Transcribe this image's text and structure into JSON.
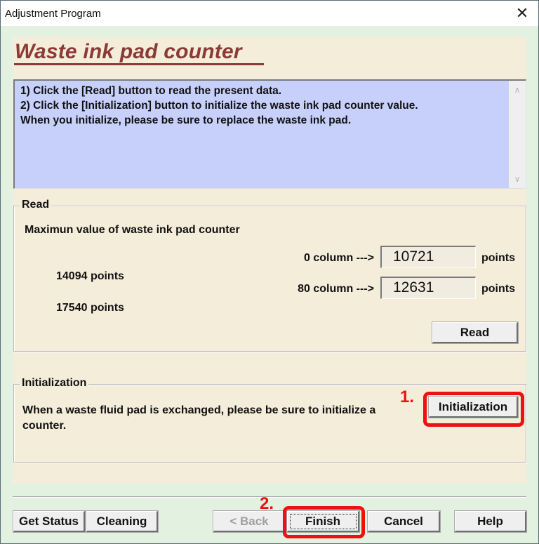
{
  "window": {
    "title": "Adjustment Program",
    "close_icon": "✕"
  },
  "header": {
    "title": "Waste ink pad counter"
  },
  "instructions": {
    "lines": [
      "1) Click the [Read] button to read the present data.",
      "2) Click the [Initialization] button to initialize the waste ink pad counter value.",
      "When you initialize, please be sure to replace the waste ink pad."
    ],
    "scroll_up_icon": "∧",
    "scroll_down_icon": "∨"
  },
  "read_group": {
    "label": "Read",
    "max_label": "Maximun value of waste ink pad counter",
    "max_values": [
      "14094 points",
      "17540 points"
    ],
    "columns": [
      {
        "label": "0 column --->",
        "value": "10721",
        "unit": "points"
      },
      {
        "label": "80 column --->",
        "value": "12631",
        "unit": "points"
      }
    ],
    "read_button": "Read"
  },
  "init_group": {
    "label": "Initialization",
    "text": "When a waste fluid pad is exchanged, please be sure to initialize a counter.",
    "button": "Initialization"
  },
  "annotations": {
    "step1": "1.",
    "step2": "2.",
    "color": "#ee1111"
  },
  "footer": {
    "get_status": "Get Status",
    "cleaning": "Cleaning",
    "back": "< Back",
    "finish": "Finish",
    "cancel": "Cancel",
    "help": "Help"
  },
  "colors": {
    "title_color": "#8b3a35",
    "panel_bg": "#f4edda",
    "info_bg": "#c7d0fb",
    "window_bg": "#e3f1e1"
  }
}
